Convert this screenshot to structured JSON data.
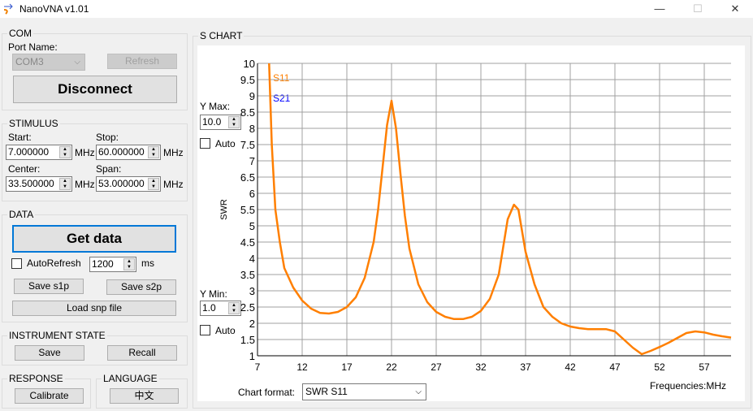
{
  "window": {
    "title": "NanoVNA v1.01",
    "minimize": "—",
    "maximize": "☐",
    "close": "✕"
  },
  "com": {
    "legend": "COM",
    "port_label": "Port Name:",
    "port_value": "COM3",
    "refresh": "Refresh",
    "disconnect": "Disconnect"
  },
  "stimulus": {
    "legend": "STIMULUS",
    "start_label": "Start:",
    "start": "7.000000",
    "stop_label": "Stop:",
    "stop": "60.000000",
    "center_label": "Center:",
    "center": "33.500000",
    "span_label": "Span:",
    "span": "53.000000",
    "unit": "MHz"
  },
  "data": {
    "legend": "DATA",
    "get_data": "Get data",
    "autorefresh_label": "AutoRefresh",
    "autorefresh_checked": false,
    "interval": "1200",
    "interval_unit": "ms",
    "save_s1p": "Save s1p",
    "save_s2p": "Save s2p",
    "load_snp": "Load snp file"
  },
  "instrument": {
    "legend": "INSTRUMENT STATE",
    "save": "Save",
    "recall": "Recall"
  },
  "response": {
    "legend": "RESPONSE",
    "calibrate": "Calibrate"
  },
  "language": {
    "legend": "LANGUAGE",
    "button": "中文"
  },
  "chart": {
    "legend": "S CHART",
    "ymax_label": "Y Max:",
    "ymax": "10.0",
    "ymin_label": "Y Min:",
    "ymin": "1.0",
    "auto_label": "Auto",
    "format_label": "Chart format:",
    "format_value": "SWR S11"
  },
  "colors": {
    "s11": "#ff7f00",
    "s21": "#0000ff",
    "grid": "#a0a0a0",
    "focus": "#0078d7"
  },
  "chart_data": {
    "type": "line",
    "ylabel": "SWR",
    "xlabel": "Frequencies:MHz",
    "xlim": [
      7,
      60
    ],
    "ylim": [
      1,
      10
    ],
    "grid": true,
    "xticks": [
      "7",
      "12",
      "17",
      "22",
      "27",
      "32",
      "37",
      "42",
      "47",
      "52",
      "57"
    ],
    "yticks": [
      "1",
      "1.5",
      "2",
      "2.5",
      "3",
      "3.5",
      "4",
      "4.5",
      "5",
      "5.5",
      "6",
      "6.5",
      "7",
      "7.5",
      "8",
      "8.5",
      "9",
      "9.5",
      "10"
    ],
    "legend": [
      "S11",
      "S21"
    ],
    "series": [
      {
        "name": "S11",
        "x": [
          8.3,
          8.6,
          9,
          9.5,
          10,
          11,
          12,
          13,
          14,
          15,
          16,
          17,
          18,
          19,
          20,
          20.5,
          21,
          21.5,
          22,
          22.5,
          23,
          23.5,
          24,
          25,
          26,
          27,
          28,
          29,
          30,
          31,
          32,
          33,
          34,
          35,
          35.7,
          36.2,
          37,
          38,
          39,
          40,
          41,
          42,
          43,
          44,
          45,
          46,
          47,
          48,
          49,
          50,
          51,
          52,
          53,
          54,
          55,
          56,
          57,
          58,
          59,
          60
        ],
        "y": [
          10,
          7.5,
          5.5,
          4.5,
          3.7,
          3.1,
          2.7,
          2.45,
          2.32,
          2.3,
          2.35,
          2.5,
          2.8,
          3.4,
          4.5,
          5.5,
          6.8,
          8.1,
          8.85,
          8.0,
          6.6,
          5.3,
          4.3,
          3.2,
          2.65,
          2.35,
          2.2,
          2.13,
          2.13,
          2.2,
          2.38,
          2.75,
          3.5,
          5.2,
          5.65,
          5.5,
          4.2,
          3.2,
          2.5,
          2.2,
          2.0,
          1.9,
          1.85,
          1.82,
          1.82,
          1.82,
          1.75,
          1.5,
          1.25,
          1.05,
          1.15,
          1.27,
          1.4,
          1.55,
          1.7,
          1.75,
          1.72,
          1.65,
          1.6,
          1.56
        ]
      }
    ]
  }
}
